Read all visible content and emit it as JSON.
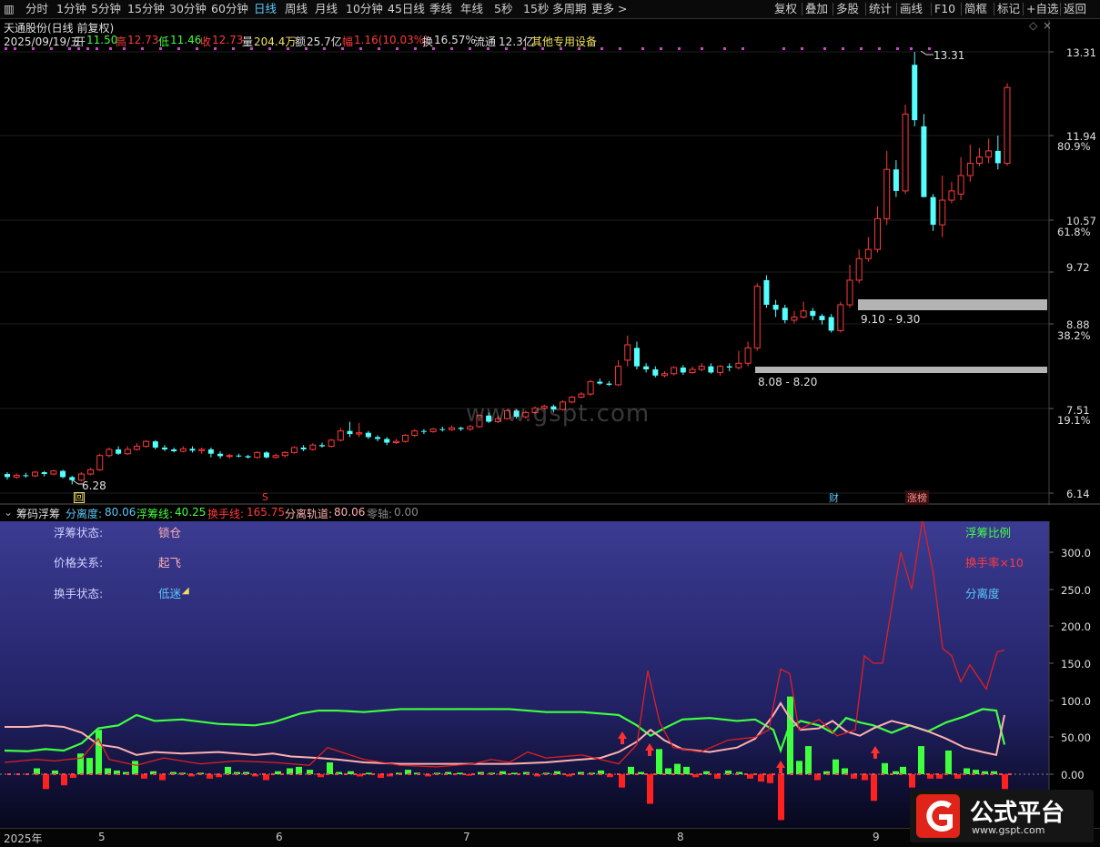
{
  "toolbar": {
    "left_items": [
      "分时",
      "1分钟",
      "5分钟",
      "15分钟",
      "30分钟",
      "60分钟",
      "日线",
      "周线",
      "月线",
      "10分钟",
      "45日线",
      "季线",
      "年线",
      "5秒",
      "15秒",
      "多周期",
      "更多 >"
    ],
    "active": "日线",
    "right_items": [
      "复权",
      "叠加",
      "多股",
      "统计",
      "画线",
      "F10",
      "简框",
      "标记",
      "+自选",
      "返回"
    ]
  },
  "stock": {
    "name": "天通股份(日线 前复权)",
    "date": "2025/09/19/五",
    "open_label": "开",
    "open": "11.50",
    "high_label": "高",
    "high": "12.73",
    "low_label": "低",
    "low": "11.46",
    "close_label": "收",
    "close": "12.73",
    "volume_label": "量",
    "volume": "204.4万",
    "amount_label": "额",
    "amount": "25.7亿",
    "change_label": "幅",
    "change": "1.16(10.03%)",
    "turnover_label": "换",
    "turnover": "16.57%",
    "float_label": "流通",
    "float": "12.3亿",
    "sector": "其他专用设备"
  },
  "price_axis": {
    "levels": [
      "13.31",
      "11.94",
      "10.57",
      "9.72",
      "8.88",
      "7.51",
      "6.14"
    ],
    "percents": [
      "80.9%",
      "61.8%",
      "38.2%",
      "19.1%"
    ]
  },
  "annotations": {
    "high_mark": "13.31",
    "low_mark": "6.28",
    "zone1": "9.10 - 9.30",
    "zone2": "8.08 - 8.20",
    "tag_hui": "回",
    "tag_s": "S",
    "tag_cai": "财",
    "tag_zhangbang": "涨榜"
  },
  "indicator": {
    "name": "筹码浮筹",
    "fenli_label": "分离度:",
    "fenli_value": "80.06",
    "fuchou_label": "浮筹线:",
    "fuchou_value": "40.25",
    "huanshou_label": "换手线:",
    "huanshou_value": "165.75",
    "guidao_label": "分离轨道:",
    "guidao_value": "80.06",
    "zero_label": "零轴:",
    "zero_value": "0.00",
    "status": [
      {
        "label": "浮筹状态:",
        "value": "锁仓"
      },
      {
        "label": "价格关系:",
        "value": "起飞"
      },
      {
        "label": "换手状态:",
        "value": "低迷"
      }
    ],
    "legend": [
      "浮筹比例",
      "换手率×10",
      "分离度"
    ],
    "axis": [
      "300.0",
      "250.0",
      "200.0",
      "150.0",
      "100.0",
      "50.00",
      "0.00"
    ]
  },
  "colors": {
    "up": "#ff3b3b",
    "down": "#54ffff",
    "green": "#3fff3f",
    "pink": "#ffb0b0",
    "red_line": "#e02020",
    "zone": "#b4b4b4",
    "panel_top": "#3a3a90",
    "panel_bottom": "#0a0a2a"
  },
  "time_axis": [
    "2025年",
    "5",
    "6",
    "7",
    "8",
    "9"
  ],
  "watermark": "www.gspt.com",
  "logo": {
    "name": "公式平台",
    "url": "www.gspt.com"
  }
}
